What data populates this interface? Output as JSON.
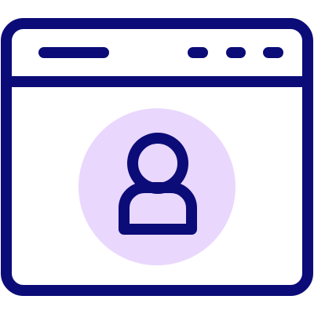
{
  "icon": {
    "name": "browser-window-user-profile-icon",
    "colors": {
      "stroke": "#0c0c78",
      "accent_fill": "#e9d7fd",
      "background": "#ffffff"
    }
  }
}
